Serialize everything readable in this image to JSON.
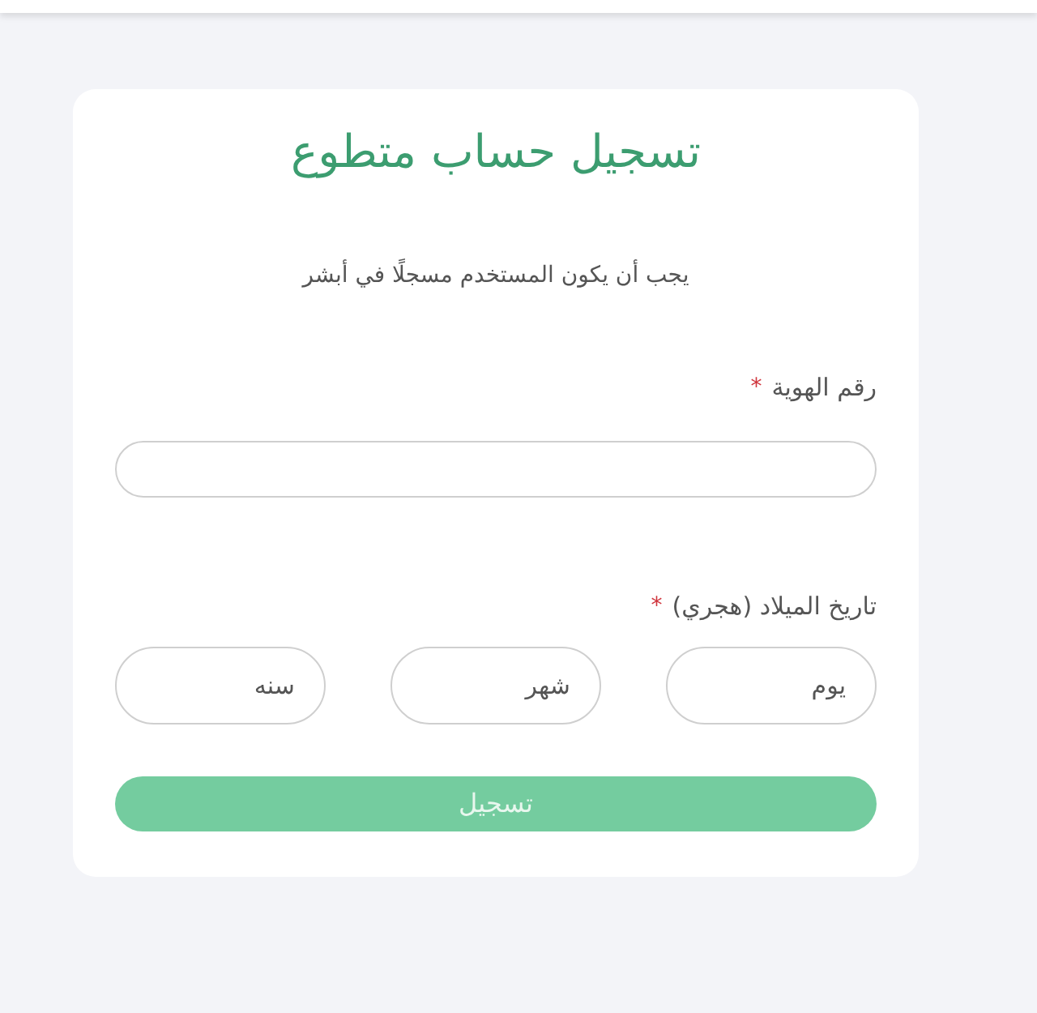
{
  "form": {
    "title": "تسجيل حساب متطوع",
    "subtitle": "يجب أن يكون المستخدم مسجلًا في أبشر",
    "id_field": {
      "label": "رقم الهوية",
      "required_mark": "*"
    },
    "birth_date": {
      "label": "تاريخ الميلاد (هجري)",
      "required_mark": "*",
      "fields": [
        {
          "placeholder": "يوم"
        },
        {
          "placeholder": "شهر"
        },
        {
          "placeholder": "سنه"
        }
      ]
    },
    "submit_button": "تسجيل"
  }
}
